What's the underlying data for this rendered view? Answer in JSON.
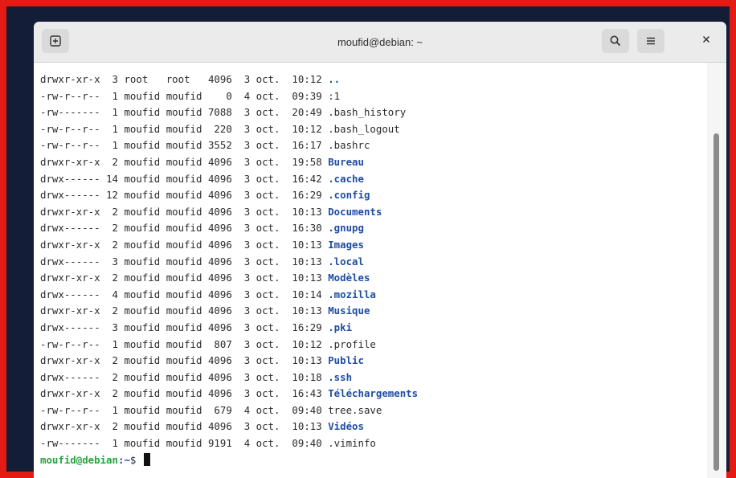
{
  "window": {
    "title": "moufid@debian: ~"
  },
  "icons": {
    "new_tab": "new-tab-icon",
    "search": "search-icon",
    "menu": "hamburger-menu-icon",
    "close": "close-icon"
  },
  "colors": {
    "directory": "#1f4da4",
    "prompt_user": "#26a33b",
    "text": "#2b2b2b"
  },
  "listing": [
    {
      "perms": "drwxr-xr-x",
      "links": " 3",
      "owner": "root  ",
      "group": "root  ",
      "size": "4096",
      "day": "3",
      "month": "oct.",
      "time": "10:12",
      "name": "..",
      "is_dir": true
    },
    {
      "perms": "-rw-r--r--",
      "links": " 1",
      "owner": "moufid",
      "group": "moufid",
      "size": "   0",
      "day": "4",
      "month": "oct.",
      "time": "09:39",
      "name": ":1",
      "is_dir": false
    },
    {
      "perms": "-rw-------",
      "links": " 1",
      "owner": "moufid",
      "group": "moufid",
      "size": "7088",
      "day": "3",
      "month": "oct.",
      "time": "20:49",
      "name": ".bash_history",
      "is_dir": false
    },
    {
      "perms": "-rw-r--r--",
      "links": " 1",
      "owner": "moufid",
      "group": "moufid",
      "size": " 220",
      "day": "3",
      "month": "oct.",
      "time": "10:12",
      "name": ".bash_logout",
      "is_dir": false
    },
    {
      "perms": "-rw-r--r--",
      "links": " 1",
      "owner": "moufid",
      "group": "moufid",
      "size": "3552",
      "day": "3",
      "month": "oct.",
      "time": "16:17",
      "name": ".bashrc",
      "is_dir": false
    },
    {
      "perms": "drwxr-xr-x",
      "links": " 2",
      "owner": "moufid",
      "group": "moufid",
      "size": "4096",
      "day": "3",
      "month": "oct.",
      "time": "19:58",
      "name": "Bureau",
      "is_dir": true
    },
    {
      "perms": "drwx------",
      "links": "14",
      "owner": "moufid",
      "group": "moufid",
      "size": "4096",
      "day": "3",
      "month": "oct.",
      "time": "16:42",
      "name": ".cache",
      "is_dir": true
    },
    {
      "perms": "drwx------",
      "links": "12",
      "owner": "moufid",
      "group": "moufid",
      "size": "4096",
      "day": "3",
      "month": "oct.",
      "time": "16:29",
      "name": ".config",
      "is_dir": true
    },
    {
      "perms": "drwxr-xr-x",
      "links": " 2",
      "owner": "moufid",
      "group": "moufid",
      "size": "4096",
      "day": "3",
      "month": "oct.",
      "time": "10:13",
      "name": "Documents",
      "is_dir": true
    },
    {
      "perms": "drwx------",
      "links": " 2",
      "owner": "moufid",
      "group": "moufid",
      "size": "4096",
      "day": "3",
      "month": "oct.",
      "time": "16:30",
      "name": ".gnupg",
      "is_dir": true
    },
    {
      "perms": "drwxr-xr-x",
      "links": " 2",
      "owner": "moufid",
      "group": "moufid",
      "size": "4096",
      "day": "3",
      "month": "oct.",
      "time": "10:13",
      "name": "Images",
      "is_dir": true
    },
    {
      "perms": "drwx------",
      "links": " 3",
      "owner": "moufid",
      "group": "moufid",
      "size": "4096",
      "day": "3",
      "month": "oct.",
      "time": "10:13",
      "name": ".local",
      "is_dir": true
    },
    {
      "perms": "drwxr-xr-x",
      "links": " 2",
      "owner": "moufid",
      "group": "moufid",
      "size": "4096",
      "day": "3",
      "month": "oct.",
      "time": "10:13",
      "name": "Modèles",
      "is_dir": true
    },
    {
      "perms": "drwx------",
      "links": " 4",
      "owner": "moufid",
      "group": "moufid",
      "size": "4096",
      "day": "3",
      "month": "oct.",
      "time": "10:14",
      "name": ".mozilla",
      "is_dir": true
    },
    {
      "perms": "drwxr-xr-x",
      "links": " 2",
      "owner": "moufid",
      "group": "moufid",
      "size": "4096",
      "day": "3",
      "month": "oct.",
      "time": "10:13",
      "name": "Musique",
      "is_dir": true
    },
    {
      "perms": "drwx------",
      "links": " 3",
      "owner": "moufid",
      "group": "moufid",
      "size": "4096",
      "day": "3",
      "month": "oct.",
      "time": "16:29",
      "name": ".pki",
      "is_dir": true
    },
    {
      "perms": "-rw-r--r--",
      "links": " 1",
      "owner": "moufid",
      "group": "moufid",
      "size": " 807",
      "day": "3",
      "month": "oct.",
      "time": "10:12",
      "name": ".profile",
      "is_dir": false
    },
    {
      "perms": "drwxr-xr-x",
      "links": " 2",
      "owner": "moufid",
      "group": "moufid",
      "size": "4096",
      "day": "3",
      "month": "oct.",
      "time": "10:13",
      "name": "Public",
      "is_dir": true
    },
    {
      "perms": "drwx------",
      "links": " 2",
      "owner": "moufid",
      "group": "moufid",
      "size": "4096",
      "day": "3",
      "month": "oct.",
      "time": "10:18",
      "name": ".ssh",
      "is_dir": true
    },
    {
      "perms": "drwxr-xr-x",
      "links": " 2",
      "owner": "moufid",
      "group": "moufid",
      "size": "4096",
      "day": "3",
      "month": "oct.",
      "time": "16:43",
      "name": "Téléchargements",
      "is_dir": true
    },
    {
      "perms": "-rw-r--r--",
      "links": " 1",
      "owner": "moufid",
      "group": "moufid",
      "size": " 679",
      "day": "4",
      "month": "oct.",
      "time": "09:40",
      "name": "tree.save",
      "is_dir": false
    },
    {
      "perms": "drwxr-xr-x",
      "links": " 2",
      "owner": "moufid",
      "group": "moufid",
      "size": "4096",
      "day": "3",
      "month": "oct.",
      "time": "10:13",
      "name": "Vidéos",
      "is_dir": true
    },
    {
      "perms": "-rw-------",
      "links": " 1",
      "owner": "moufid",
      "group": "moufid",
      "size": "9191",
      "day": "4",
      "month": "oct.",
      "time": "09:40",
      "name": ".viminfo",
      "is_dir": false
    }
  ],
  "prompt": {
    "user_host": "moufid@debian",
    "path": ":~",
    "symbol": "$ "
  }
}
